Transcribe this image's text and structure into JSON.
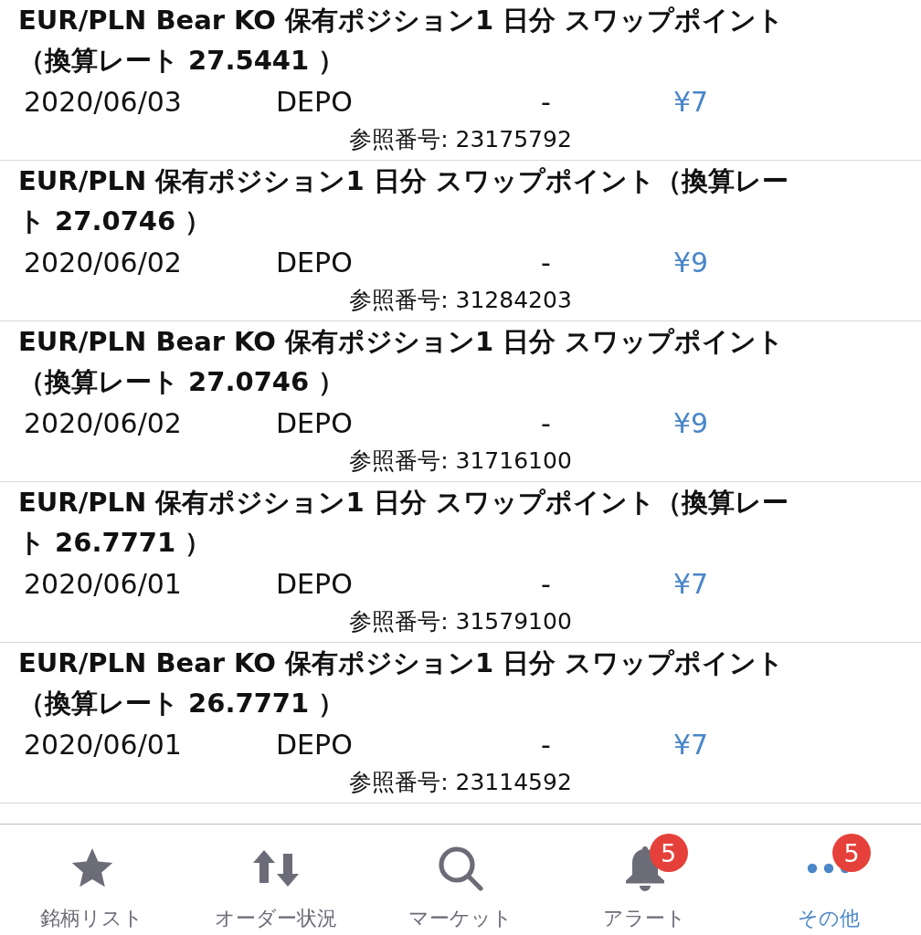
{
  "entries": [
    {
      "title_lines": [
        "EUR/PLN Bear KO 保有ポジション1 日分 スワップポイント",
        "（換算レート 27.5441 ）"
      ],
      "date": "2020/06/03",
      "type": "DEPO",
      "dash": "-",
      "amount": "¥7",
      "reference": "参照番号: 23175792"
    },
    {
      "title_lines": [
        "EUR/PLN 保有ポジション1 日分 スワップポイント（換算レー",
        "ト 27.0746 ）"
      ],
      "date": "2020/06/02",
      "type": "DEPO",
      "dash": "-",
      "amount": "¥9",
      "reference": "参照番号: 31284203"
    },
    {
      "title_lines": [
        "EUR/PLN Bear KO 保有ポジション1 日分 スワップポイント",
        "（換算レート 27.0746 ）"
      ],
      "date": "2020/06/02",
      "type": "DEPO",
      "dash": "-",
      "amount": "¥9",
      "reference": "参照番号: 31716100"
    },
    {
      "title_lines": [
        "EUR/PLN 保有ポジション1 日分 スワップポイント（換算レー",
        "ト 26.7771 ）"
      ],
      "date": "2020/06/01",
      "type": "DEPO",
      "dash": "-",
      "amount": "¥7",
      "reference": "参照番号: 31579100"
    },
    {
      "title_lines": [
        "EUR/PLN Bear KO 保有ポジション1 日分 スワップポイント",
        "（換算レート 26.7771 ）"
      ],
      "date": "2020/06/01",
      "type": "DEPO",
      "dash": "-",
      "amount": "¥7",
      "reference": "参照番号: 23114592"
    }
  ],
  "tab_bar": [
    {
      "kind": "star",
      "label": "銘柄リスト",
      "selected": false
    },
    {
      "kind": "arrows",
      "label": "オーダー状況",
      "selected": false
    },
    {
      "kind": "search",
      "label": "マーケット",
      "selected": false
    },
    {
      "kind": "bell",
      "label": "アラート",
      "selected": false,
      "badge": "5"
    },
    {
      "kind": "more",
      "label": "その他",
      "selected": true,
      "badge": "5"
    }
  ]
}
